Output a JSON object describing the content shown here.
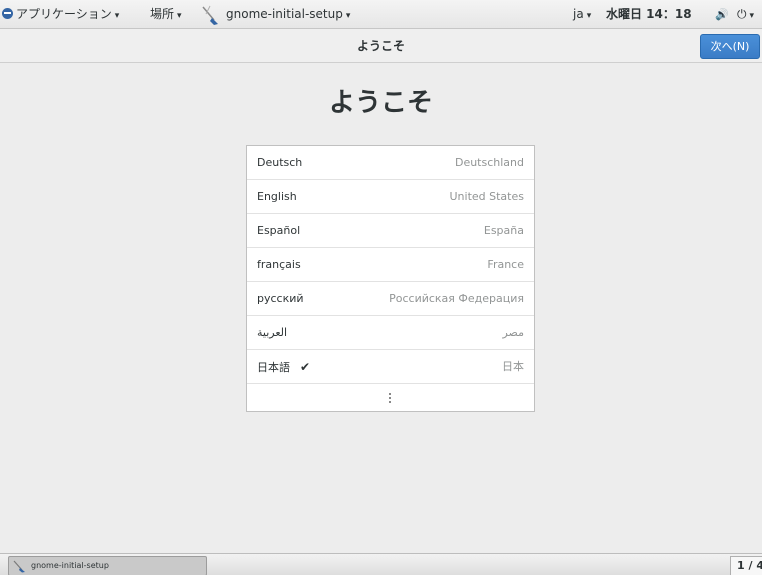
{
  "top_panel": {
    "applications_label": "アプリケーション",
    "places_label": "場所",
    "app_menu_label": "gnome-initial-setup",
    "input_source": "ja",
    "clock": "水曜日 14：18",
    "caret": "▾",
    "volume_glyph": "🔊",
    "power_glyph": "⏻"
  },
  "header": {
    "title": "ようこそ",
    "next_button_label": "次へ(N)"
  },
  "main": {
    "title": "ようこそ",
    "check_glyph": "✔",
    "languages": [
      {
        "name": "Deutsch",
        "region": "Deutschland",
        "selected": false
      },
      {
        "name": "English",
        "region": "United States",
        "selected": false
      },
      {
        "name": "Español",
        "region": "España",
        "selected": false
      },
      {
        "name": "français",
        "region": "France",
        "selected": false
      },
      {
        "name": "русский",
        "region": "Российская Федерация",
        "selected": false
      },
      {
        "name": "العربية",
        "region": "مصر",
        "selected": false
      },
      {
        "name": "日本語",
        "region": "日本",
        "selected": true
      }
    ]
  },
  "bottom_panel": {
    "task_label": "gnome-initial-setup",
    "workspace": "1 / 4"
  },
  "colors": {
    "accent": "#4a90d9",
    "panel_bg": "#ededed",
    "secondary_text": "#929595"
  }
}
